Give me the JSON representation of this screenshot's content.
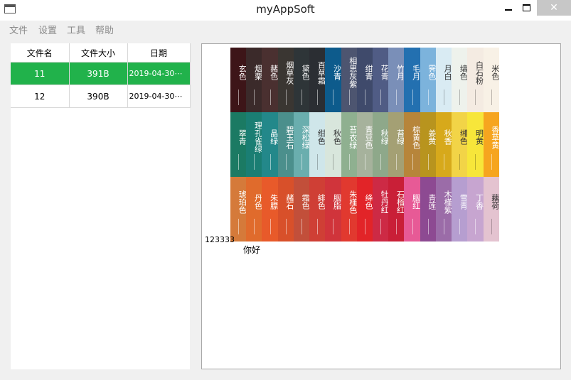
{
  "window": {
    "title": "myAppSoft",
    "close_glyph": "✕"
  },
  "menu": [
    "文件",
    "设置",
    "工具",
    "帮助"
  ],
  "table": {
    "headers": [
      "文件名",
      "文件大小",
      "日期"
    ],
    "rows": [
      {
        "name": "11",
        "size": "391B",
        "date": "2019-04-30⋯",
        "selected": true
      },
      {
        "name": "12",
        "size": "390B",
        "date": "2019-04-30⋯",
        "selected": false
      }
    ]
  },
  "image": {
    "swatches": [
      {
        "name": "玄色",
        "color": "#3d1518"
      },
      {
        "name": "烟栗",
        "color": "#3b2a2a"
      },
      {
        "name": "赭色",
        "color": "#4a3030"
      },
      {
        "name": "烟草灰",
        "color": "#3a3632"
      },
      {
        "name": "黛色",
        "color": "#2e3538"
      },
      {
        "name": "百草霜",
        "color": "#2b2e33"
      },
      {
        "name": "沙青",
        "color": "#0d5b8c"
      },
      {
        "name": "相思灰紫",
        "color": "#4d5570"
      },
      {
        "name": "绀青",
        "color": "#3f4a6b"
      },
      {
        "name": "花青",
        "color": "#505c85"
      },
      {
        "name": "竹月",
        "color": "#7a8fb8"
      },
      {
        "name": "毛月",
        "color": "#2370b0"
      },
      {
        "name": "霁色",
        "color": "#7cb3dc"
      },
      {
        "name": "月白",
        "color": "#d9ebf3"
      },
      {
        "name": "缟色",
        "color": "#eef2ec"
      },
      {
        "name": "白石粉",
        "color": "#f4ebe2"
      },
      {
        "name": "米色",
        "color": "#f8f1e6"
      },
      {
        "name": "",
        "color": "#ffffff"
      },
      {
        "name": "翠青",
        "color": "#1b7a63"
      },
      {
        "name": "理孔雀绿",
        "color": "#1a7e73"
      },
      {
        "name": "晶绿",
        "color": "#23888a"
      },
      {
        "name": "碧玉石",
        "color": "#4b8f8c"
      },
      {
        "name": "深松绿",
        "color": "#6aaeae"
      },
      {
        "name": "绀色",
        "color": "#cfe6ea"
      },
      {
        "name": "秋色",
        "color": "#d8e6dc"
      },
      {
        "name": "苔衣绿",
        "color": "#8fb090"
      },
      {
        "name": "青豆色",
        "color": "#a6b29c"
      },
      {
        "name": "秋绿",
        "color": "#8ea88a"
      },
      {
        "name": "苔绿",
        "color": "#a4a074"
      },
      {
        "name": "棕黄色",
        "color": "#b7853a"
      },
      {
        "name": "姜黄",
        "color": "#b8941e"
      },
      {
        "name": "秋香",
        "color": "#d7a91b"
      },
      {
        "name": "缃色",
        "color": "#f2d447"
      },
      {
        "name": "明黄",
        "color": "#f7e63a"
      },
      {
        "name": "香草黄",
        "color": "#f6a51f"
      },
      {
        "name": "",
        "color": "#ffffff"
      },
      {
        "name": "琥珀色",
        "color": "#d57a3a"
      },
      {
        "name": "丹色",
        "color": "#e06b2c"
      },
      {
        "name": "朱膘",
        "color": "#e85a2a"
      },
      {
        "name": "赭石",
        "color": "#d8502a"
      },
      {
        "name": "霜色",
        "color": "#c24f3a"
      },
      {
        "name": "緋色",
        "color": "#cf3f35"
      },
      {
        "name": "胭脂",
        "color": "#d0343b"
      },
      {
        "name": "朱槿色",
        "color": "#e1392f"
      },
      {
        "name": "绛色",
        "color": "#e22428"
      },
      {
        "name": "牡丹红",
        "color": "#cd2a45"
      },
      {
        "name": "石榴红",
        "color": "#c91f37"
      },
      {
        "name": "胭红",
        "color": "#e75a96"
      },
      {
        "name": "青莲",
        "color": "#8d4a92"
      },
      {
        "name": "木槿紫",
        "color": "#9b6ca8"
      },
      {
        "name": "雪青",
        "color": "#b69ed0"
      },
      {
        "name": "丁香",
        "color": "#c7a5d0"
      },
      {
        "name": "藕荷",
        "color": "#e4c3d0"
      },
      {
        "name": "",
        "color": "#ffffff"
      }
    ]
  },
  "labels": {
    "number": "123333",
    "greeting": "你好"
  }
}
